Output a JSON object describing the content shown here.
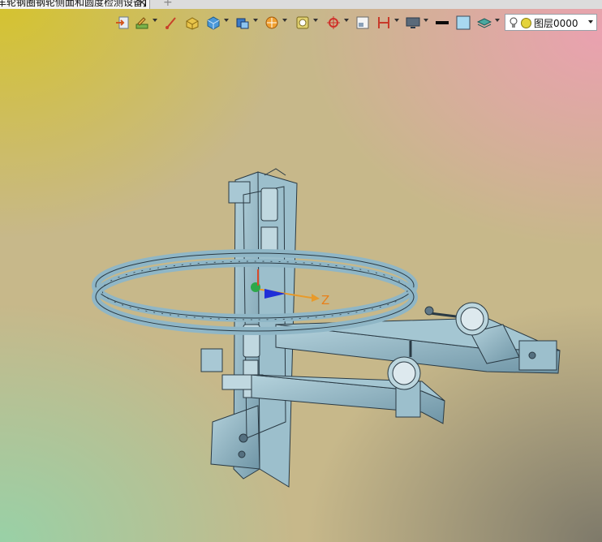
{
  "document_tab": {
    "title": "车轮钢圈钢轮侧面和圆度检测设备】",
    "close_glyph": "✕",
    "new_tab_glyph": "+"
  },
  "toolbar": {
    "buttons": [
      {
        "icon": "import-icon",
        "has_dropdown": false
      },
      {
        "icon": "sketch-pen-icon",
        "has_dropdown": true
      },
      {
        "icon": "draw-line-icon",
        "has_dropdown": false
      },
      {
        "icon": "extrude-box-icon",
        "has_dropdown": false
      },
      {
        "icon": "cube-display-icon",
        "has_dropdown": true
      },
      {
        "icon": "solid-view-icon",
        "has_dropdown": true
      },
      {
        "icon": "orient-view-icon",
        "has_dropdown": true
      },
      {
        "icon": "render-style-icon",
        "has_dropdown": true
      },
      {
        "icon": "snap-target-icon",
        "has_dropdown": true
      },
      {
        "icon": "measure-icon",
        "has_dropdown": false
      },
      {
        "icon": "dimension-icon",
        "has_dropdown": true
      },
      {
        "icon": "display-monitor-icon",
        "has_dropdown": true
      },
      {
        "icon": "line-color-icon",
        "has_dropdown": false
      },
      {
        "icon": "fill-color-icon",
        "has_dropdown": false
      },
      {
        "icon": "layer-stack-icon",
        "has_dropdown": true
      }
    ],
    "layer": {
      "name": "图层0000",
      "accent": "#e4d33a"
    }
  },
  "viewport": {
    "triad_axis_label": "Z",
    "colors": {
      "part": "#8fb6c6",
      "edge": "#2a3a44",
      "axis_z": "#e89a2a",
      "triad_blue": "#1f2fd8",
      "triad_green": "#2da84a",
      "triad_red": "#d84a2a"
    }
  }
}
